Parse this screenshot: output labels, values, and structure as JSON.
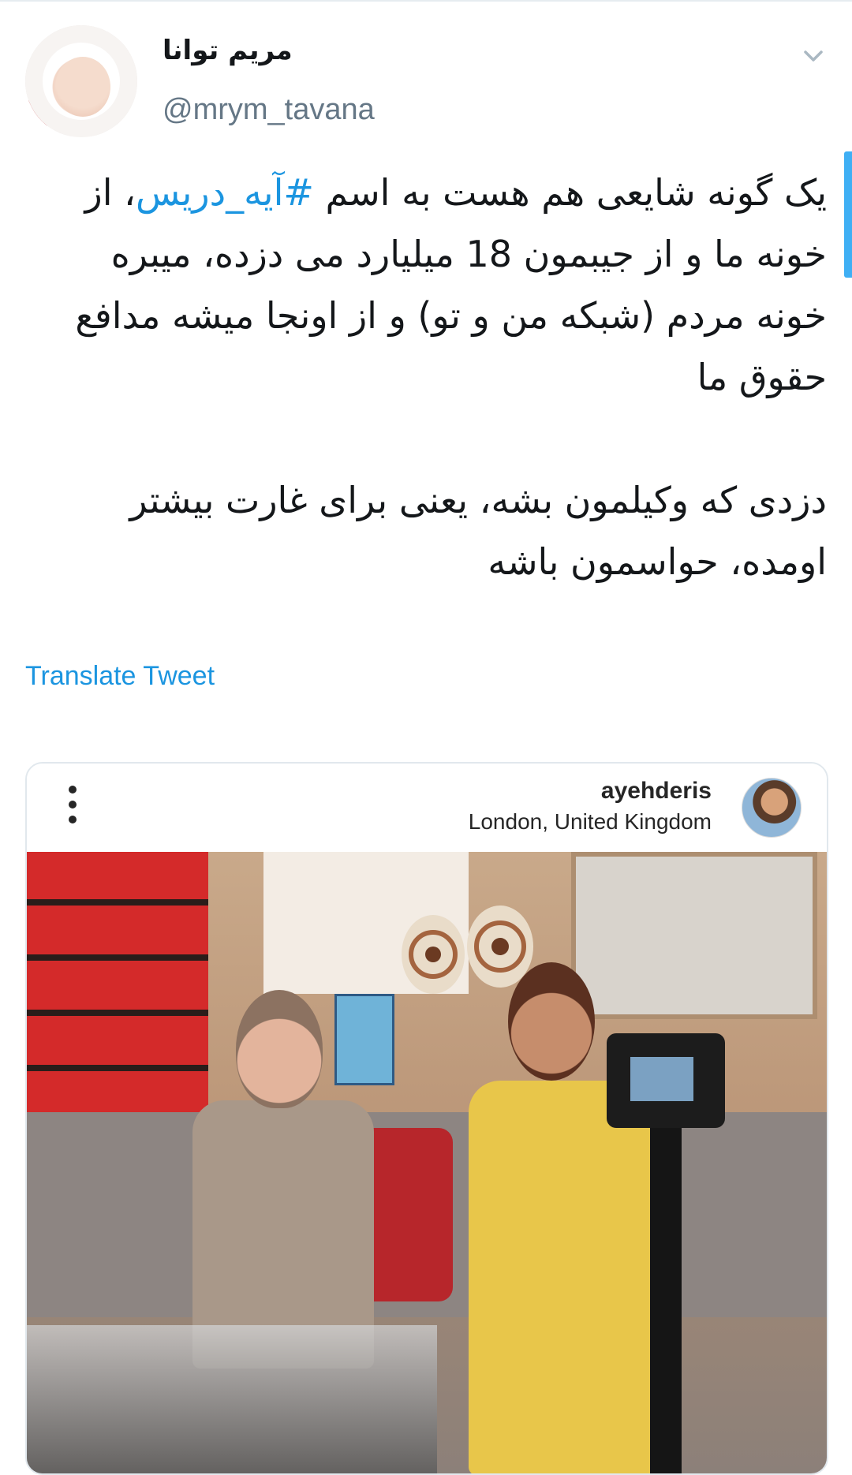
{
  "user": {
    "display_name": "مریم توانا",
    "handle": "@mrym_tavana"
  },
  "tweet": {
    "lines_p1_before_hashtag": "یک گونه شایعی هم هست به اسم ",
    "hashtag": "#آیه_دریس",
    "lines_p1_after_hashtag": "، از خونه ما و از جیبمون 18 میلیارد می دزده، میبره خونه مردم (شبکه من و تو) و از اونجا میشه مدافع حقوق ما",
    "paragraph2": "دزدی که وکیلمون بشه، یعنی برای غارت بیشتر اومده، حواسمون باشه"
  },
  "translate_label": "Translate Tweet",
  "embed": {
    "username": "ayehderis",
    "location": "London, United Kingdom"
  },
  "icons": {
    "chevron": "chevron-down-icon",
    "more": "more-vertical-icon"
  },
  "colors": {
    "link": "#1b95e0",
    "text": "#14171a",
    "muted": "#657786"
  }
}
